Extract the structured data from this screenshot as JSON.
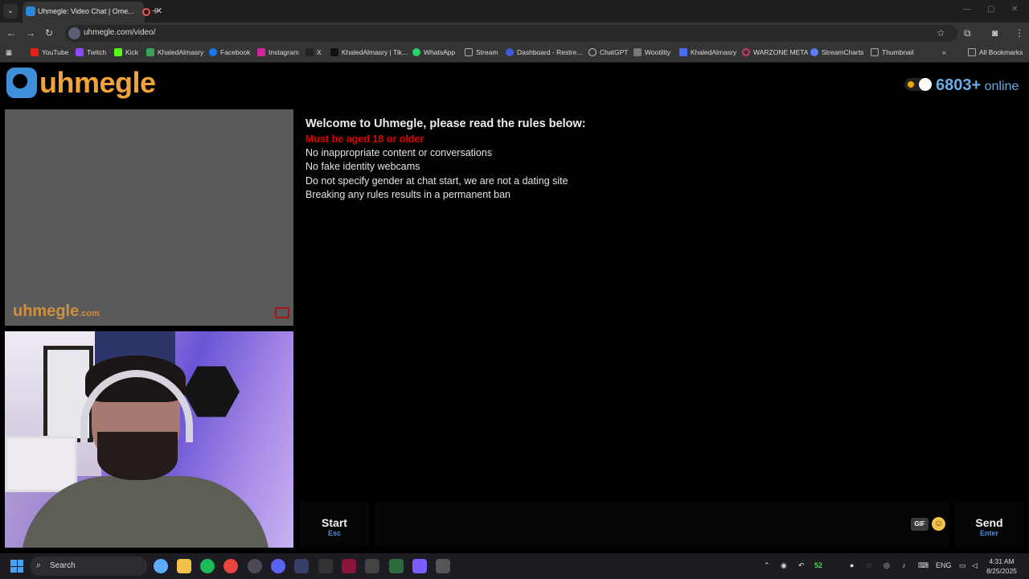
{
  "browser": {
    "tab": {
      "title": "Uhmegle: Video Chat | Ome..."
    },
    "address": {
      "url": "uhmegle.com/video/"
    },
    "bookmarks": [
      {
        "label": "YouTube",
        "color": "#e62117"
      },
      {
        "label": "Twitch",
        "color": "#9146ff"
      },
      {
        "label": "Kick",
        "color": "#53fc18"
      },
      {
        "label": "KhaledAlmasry",
        "color": "#3aa35b"
      },
      {
        "label": "Facebook",
        "color": "#1877f2"
      },
      {
        "label": "Instagram",
        "color": "#d6249f"
      },
      {
        "label": "X",
        "color": "#222222"
      },
      {
        "label": "KhaledAlmasry | Tik...",
        "color": "#111111"
      },
      {
        "label": "WhatsApp",
        "color": "#25d366"
      },
      {
        "label": "Stream",
        "color": "#888888"
      },
      {
        "label": "Dashboard - Restre...",
        "color": "#3b5bdb"
      },
      {
        "label": "ChatGPT",
        "color": "#cccccc"
      },
      {
        "label": "Wootility",
        "color": "#777777"
      },
      {
        "label": "KhaledAlmasry",
        "color": "#4a6cf7"
      },
      {
        "label": "WARZONE META",
        "color": "#d6336c"
      },
      {
        "label": "StreamCharts",
        "color": "#5c7cfa"
      },
      {
        "label": "Thumbnail",
        "color": "#888888"
      }
    ],
    "all_bookmarks": "All Bookmarks"
  },
  "site": {
    "logo_text": "uhmegle",
    "online_count": "6803+",
    "online_label": "online",
    "watermark_main": "uhmegle",
    "watermark_suffix": ".com",
    "rules": {
      "welcome": "Welcome to Uhmegle, please read the rules below:",
      "age": "Must be aged 18 or older",
      "lines": [
        "No inappropriate content or conversations",
        "No fake identity webcams",
        "Do not specify gender at chat start, we are not a dating site",
        "Breaking any rules results in a permanent ban"
      ]
    },
    "chat": {
      "start_label": "Start",
      "start_key": "Esc",
      "gif_label": "GIF",
      "send_label": "Send",
      "send_key": "Enter"
    }
  },
  "taskbar": {
    "search_label": "Search",
    "tray_number": "52",
    "language": "ENG",
    "time": "4:31 AM",
    "date": "8/25/2025"
  }
}
